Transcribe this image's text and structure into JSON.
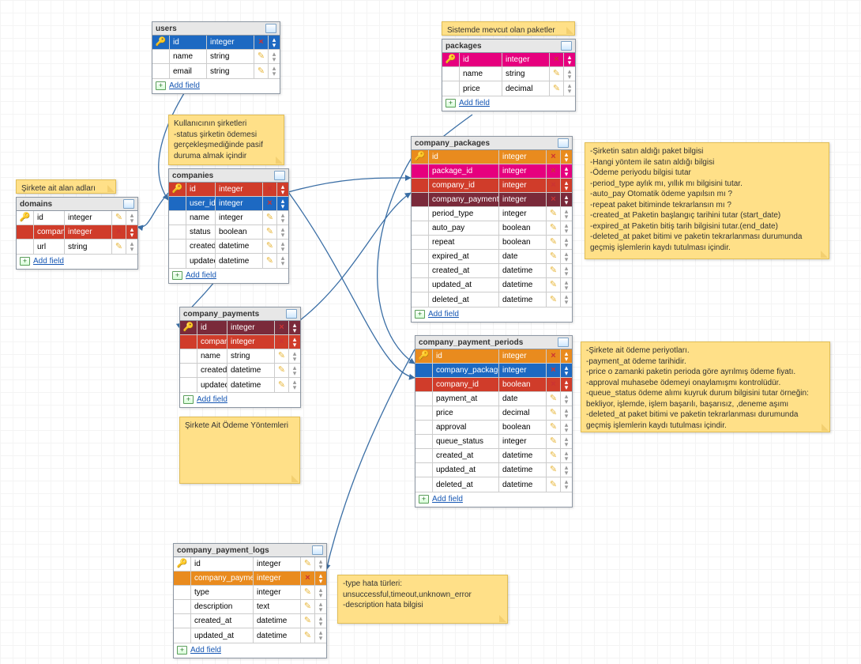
{
  "ui": {
    "addFieldLabel": "Add field"
  },
  "notes": {
    "n_packages_header": "Sistemde mevcut olan paketler",
    "n_companies_info": "Kullanıcının şirketleri\n-status şirketin ödemesi gerçekleşmediğinde pasif duruma almak içindir",
    "n_domains_header": "Şirkete ait alan adları",
    "n_company_packages": "-Şirketin satın aldığı paket bilgisi\n-Hangi yöntem ile satın aldığı bilgisi\n-Ödeme periyodu bilgisi tutar\n-period_type aylık mı, yıllık mı bilgisini tutar.\n-auto_pay Otomatik ödeme yapılsın mı ?\n-repeat paket bitiminde tekrarlansın mı ?\n-created_at Paketin başlangıç tarihini tutar (start_date)\n-expired_at Paketin bitiş tarih bilgisini tutar.(end_date)\n-deleted_at paket bitimi ve paketin tekrarlanması durumunda geçmiş işlemlerin kaydı tutulması içindir.",
    "n_company_payments_info": "Şirkete Ait Ödeme Yöntemleri",
    "n_payment_periods": "-Şirkete ait ödeme periyotları.\n-payment_at ödeme tarihidir.\n-price o zamanki paketin perioda göre ayrılmış ödeme fiyatı.\n-approval muhasebe ödemeyi onaylamışmı kontrolüdür.\n-queue_status ödeme alımı kuyruk durum bilgisini tutar örneğin: bekliyor, işlemde, işlem başarılı, başarısız, ,deneme aşımı\n-deleted_at paket bitimi ve paketin tekrarlanması durumunda geçmiş işlemlerin kaydı tutulması içindir.",
    "n_payment_logs": "-type hata türleri: unsuccessful,timeout,unknown_error\n-description hata bilgisi"
  },
  "entities": {
    "users": {
      "title": "users",
      "fields": [
        {
          "name": "id",
          "type": "integer",
          "pk": true,
          "hl": "blue"
        },
        {
          "name": "name",
          "type": "string"
        },
        {
          "name": "email",
          "type": "string"
        }
      ]
    },
    "packages": {
      "title": "packages",
      "fields": [
        {
          "name": "id",
          "type": "integer",
          "pk": true,
          "hl": "magenta"
        },
        {
          "name": "name",
          "type": "string"
        },
        {
          "name": "price",
          "type": "decimal"
        }
      ]
    },
    "companies": {
      "title": "companies",
      "fields": [
        {
          "name": "id",
          "type": "integer",
          "pk": true,
          "hl": "red"
        },
        {
          "name": "user_id",
          "type": "integer",
          "pk": false,
          "hl": "blue"
        },
        {
          "name": "name",
          "type": "integer"
        },
        {
          "name": "status",
          "type": "boolean"
        },
        {
          "name": "created_at",
          "type": "datetime"
        },
        {
          "name": "updated_at",
          "type": "datetime"
        }
      ]
    },
    "domains": {
      "title": "domains",
      "fields": [
        {
          "name": "id",
          "type": "integer",
          "pk": true
        },
        {
          "name": "company_id",
          "type": "integer",
          "hl": "red"
        },
        {
          "name": "url",
          "type": "string"
        }
      ]
    },
    "company_packages": {
      "title": "company_packages",
      "fields": [
        {
          "name": "id",
          "type": "integer",
          "pk": true,
          "hl": "orange"
        },
        {
          "name": "package_id",
          "type": "integer",
          "hl": "magenta"
        },
        {
          "name": "company_id",
          "type": "integer",
          "hl": "red"
        },
        {
          "name": "company_payment_id",
          "type": "integer",
          "hl": "maroon"
        },
        {
          "name": "period_type",
          "type": "integer"
        },
        {
          "name": "auto_pay",
          "type": "boolean"
        },
        {
          "name": "repeat",
          "type": "boolean"
        },
        {
          "name": "expired_at",
          "type": "date"
        },
        {
          "name": "created_at",
          "type": "datetime"
        },
        {
          "name": "updated_at",
          "type": "datetime"
        },
        {
          "name": "deleted_at",
          "type": "datetime"
        }
      ]
    },
    "company_payments": {
      "title": "company_payments",
      "fields": [
        {
          "name": "id",
          "type": "integer",
          "pk": true,
          "hl": "maroon"
        },
        {
          "name": "company_id",
          "type": "integer",
          "hl": "red"
        },
        {
          "name": "name",
          "type": "string"
        },
        {
          "name": "created_at",
          "type": "datetime"
        },
        {
          "name": "updated_at",
          "type": "datetime"
        }
      ]
    },
    "company_payment_periods": {
      "title": "company_payment_periods",
      "fields": [
        {
          "name": "id",
          "type": "integer",
          "pk": true,
          "hl": "orange"
        },
        {
          "name": "company_package_id",
          "type": "integer",
          "hl": "blue"
        },
        {
          "name": "company_id",
          "type": "boolean",
          "hl": "red"
        },
        {
          "name": "payment_at",
          "type": "date"
        },
        {
          "name": "price",
          "type": "decimal"
        },
        {
          "name": "approval",
          "type": "boolean"
        },
        {
          "name": "queue_status",
          "type": "integer"
        },
        {
          "name": "created_at",
          "type": "datetime"
        },
        {
          "name": "updated_at",
          "type": "datetime"
        },
        {
          "name": "deleted_at",
          "type": "datetime"
        }
      ]
    },
    "company_payment_logs": {
      "title": "company_payment_logs",
      "fields": [
        {
          "name": "id",
          "type": "integer",
          "pk": true
        },
        {
          "name": "company_payment_period_id",
          "type": "integer",
          "hl": "orange"
        },
        {
          "name": "type",
          "type": "integer"
        },
        {
          "name": "description",
          "type": "text"
        },
        {
          "name": "created_at",
          "type": "datetime"
        },
        {
          "name": "updated_at",
          "type": "datetime"
        }
      ]
    }
  }
}
